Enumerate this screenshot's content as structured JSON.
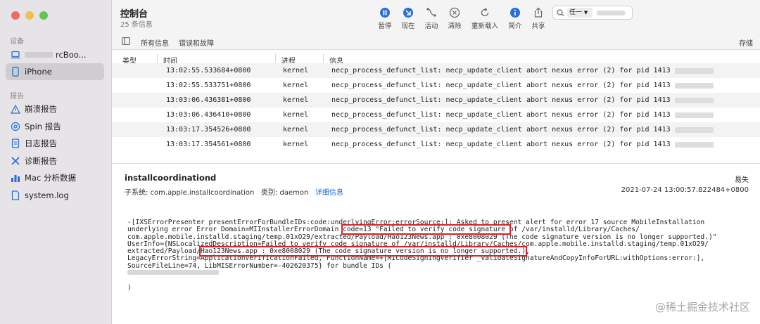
{
  "window": {
    "lights": [
      "#ec6a5e",
      "#f4bf4f",
      "#61c554"
    ]
  },
  "sidebar": {
    "devices_title": "设备",
    "mac_label": "rcBoo...",
    "iphone_label": "iPhone",
    "reports_title": "报告",
    "reports": [
      {
        "label": "崩溃报告",
        "icon": "warning-icon"
      },
      {
        "label": "Spin 报告",
        "icon": "spin-icon"
      },
      {
        "label": "日志报告",
        "icon": "document-icon"
      },
      {
        "label": "诊断报告",
        "icon": "tools-icon"
      },
      {
        "label": "Mac 分析数据",
        "icon": "bar-chart-icon"
      },
      {
        "label": "system.log",
        "icon": "file-icon"
      }
    ]
  },
  "toolbar": {
    "title": "控制台",
    "subtitle": "25 条信息",
    "buttons": [
      {
        "label": "暂停",
        "icon": "pause-icon"
      },
      {
        "label": "现在",
        "icon": "now-icon"
      },
      {
        "label": "活动",
        "icon": "activity-icon"
      },
      {
        "label": "清除",
        "icon": "clear-icon"
      },
      {
        "label": "重新载入",
        "icon": "reload-icon"
      },
      {
        "label": "简介",
        "icon": "info-icon"
      },
      {
        "label": "共享",
        "icon": "share-icon"
      }
    ],
    "search_token": "任一"
  },
  "filterbar": {
    "all": "所有信息",
    "errors": "错误和故障",
    "save": "存储"
  },
  "table": {
    "columns": [
      "类型",
      "时间",
      "进程",
      "信息"
    ],
    "rows": [
      {
        "time": "13:02:55.533684+0800",
        "process": "kernel",
        "message": "necp_process_defunct_list: necp_update_client abort nexus error (2) for pid 1413"
      },
      {
        "time": "13:02:55.533751+0800",
        "process": "kernel",
        "message": "necp_process_defunct_list: necp_update_client abort nexus error (2) for pid 1413"
      },
      {
        "time": "13:03:06.436381+0800",
        "process": "kernel",
        "message": "necp_process_defunct_list: necp_update_client abort nexus error (2) for pid 1413"
      },
      {
        "time": "13:03:06.436410+0800",
        "process": "kernel",
        "message": "necp_process_defunct_list: necp_update_client abort nexus error (2) for pid 1413"
      },
      {
        "time": "13:03:17.354526+0800",
        "process": "kernel",
        "message": "necp_process_defunct_list: necp_update_client abort nexus error (2) for pid 1413"
      },
      {
        "time": "13:03:17.354561+0800",
        "process": "kernel",
        "message": "necp_process_defunct_list: necp_update_client abort nexus error (2) for pid 1413"
      }
    ]
  },
  "detail": {
    "process": "installcoordinationd",
    "type": "易失",
    "subsystem": "子系统: com.apple.installcoordination",
    "category": "类别: daemon",
    "more_link": "详细信息",
    "timestamp": "2021-07-24 13:00:57.822484+0800",
    "message_lines": [
      "-[IXSErrorPresenter presentErrorForBundleIDs:code:underlyingError:errorSource:]: Asked to present alert for error 17 source MobileInstallation",
      "underlying error Error Domain=MIInstallerErrorDomain ",
      "com.apple.mobile.installd.staging/temp.01xO29/extracted/Payload/Hao123News.app : 0xe8008029 (The code signature version is no longer supported.)\"",
      "UserInfo={NSLocalizedDescription=Failed to verify code signature of /var/installd/Library/Caches/com.apple.mobile.installd.staging/temp.01xO29/",
      "extracted/Payload/",
      "LegacyErrorString=ApplicationVerificationFailed, FunctionName=+[MICodeSigningVerifier _validateSignatureAndCopyInfoForURL:withOptions:error:],",
      "SourceFileLine=74, LibMISErrorNumber=-402620375} for bundle IDs (",
      "",
      ")"
    ],
    "highlight1": "code=13 \"Failed to verify code signature ",
    "after_highlight1": "of /var/installd/Library/Caches/",
    "highlight2": "Hao123News.app : 0xe8008029 (The code signature version is no longer supported.)",
    "after_highlight2": ","
  },
  "watermark": "@稀土掘金技术社区"
}
